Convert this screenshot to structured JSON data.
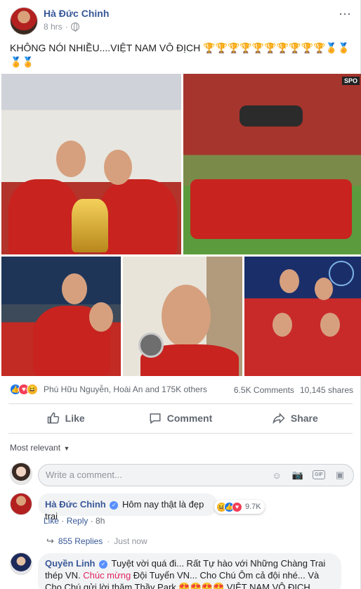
{
  "post": {
    "author": "Hà Đức Chinh",
    "time": "8 hrs",
    "more_icon": "⋯",
    "text": "KHÔNG NÓI NHIỀU....VIỆT NAM VÔ ĐỊCH 🏆🏆🏆🏆🏆🏆🏆🏆🏆🏆🏅🏅🏅🏅"
  },
  "photos": [
    {
      "icon": "photo-players-with-trophy"
    },
    {
      "icon": "photo-coach-tossed-in-air",
      "badge": "SPO"
    },
    {
      "icon": "photo-players-hugging"
    },
    {
      "icon": "photo-selfie-with-medal"
    },
    {
      "icon": "photo-team-on-stage"
    }
  ],
  "stats": {
    "reactors": "Phú Hữu Nguyễn, Hoài An and 175K others",
    "comments": "6.5K Comments",
    "shares": "10,145 shares"
  },
  "actions": {
    "like": "Like",
    "comment": "Comment",
    "share": "Share"
  },
  "comments_section": {
    "sort_label": "Most relevant",
    "input_placeholder": "Write a comment..."
  },
  "comment1": {
    "author": "Hà Đức Chinh",
    "text": "Hôm nay thật là đẹp trai",
    "reaction_count": "9.7K",
    "like": "Like",
    "reply": "Reply",
    "time": "8h",
    "replies_label": "855 Replies",
    "replies_time": "Just now"
  },
  "comment2": {
    "author": "Quyền Linh",
    "text_a": "Tuyệt vời quá đi... Rất Tự hào với Những Chàng Trai thép VN.",
    "text_highlight": "Chúc mừng",
    "text_b": "Đội Tuyển VN... Cho Chú Ôm cả đội nhé... Và Cho Chú gửi lời thăm Thầy Park",
    "emojis": "😍😍😍😍",
    "text_c": "VIỆT NAM VÔ ĐỊCH..."
  },
  "colors": {
    "link": "#385898",
    "muted": "#606770",
    "like_blue": "#1877f2",
    "love_red": "#f33e58",
    "haha_yellow": "#f7b125"
  }
}
